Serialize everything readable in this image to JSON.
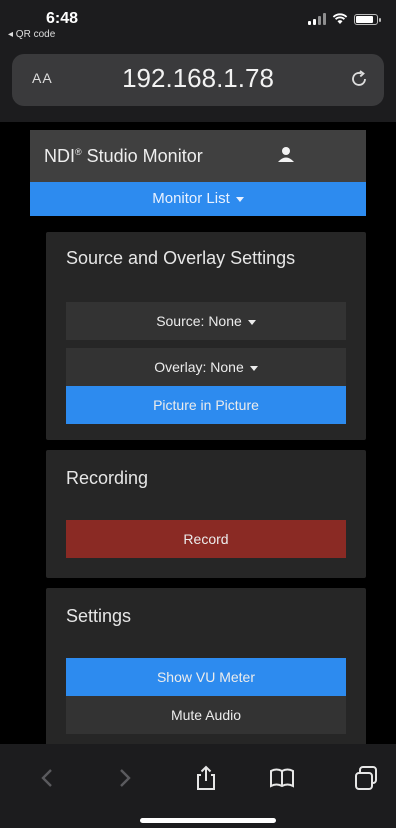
{
  "status_bar": {
    "time": "6:48",
    "back_app": "◂ QR code"
  },
  "address_bar": {
    "text_size_label": "AA",
    "url": "192.168.1.78"
  },
  "header": {
    "brand": "NDI",
    "brand_mark": "®",
    "brand_rest": " Studio Monitor",
    "monitor_list_label": "Monitor List"
  },
  "source_overlay": {
    "title": "Source and Overlay Settings",
    "source_label": "Source: None",
    "overlay_label": "Overlay: None",
    "pip_label": "Picture in Picture"
  },
  "recording": {
    "title": "Recording",
    "record_label": "Record"
  },
  "settings": {
    "title": "Settings",
    "vu_label": "Show VU Meter",
    "mute_label": "Mute Audio"
  },
  "colors": {
    "accent_blue": "#2d8bef",
    "record_red": "#8a2a24",
    "card_bg": "#262626"
  },
  "icons": [
    "back-icon",
    "forward-icon",
    "share-icon",
    "bookmarks-icon",
    "tabs-icon",
    "reload-icon",
    "user-icon"
  ]
}
